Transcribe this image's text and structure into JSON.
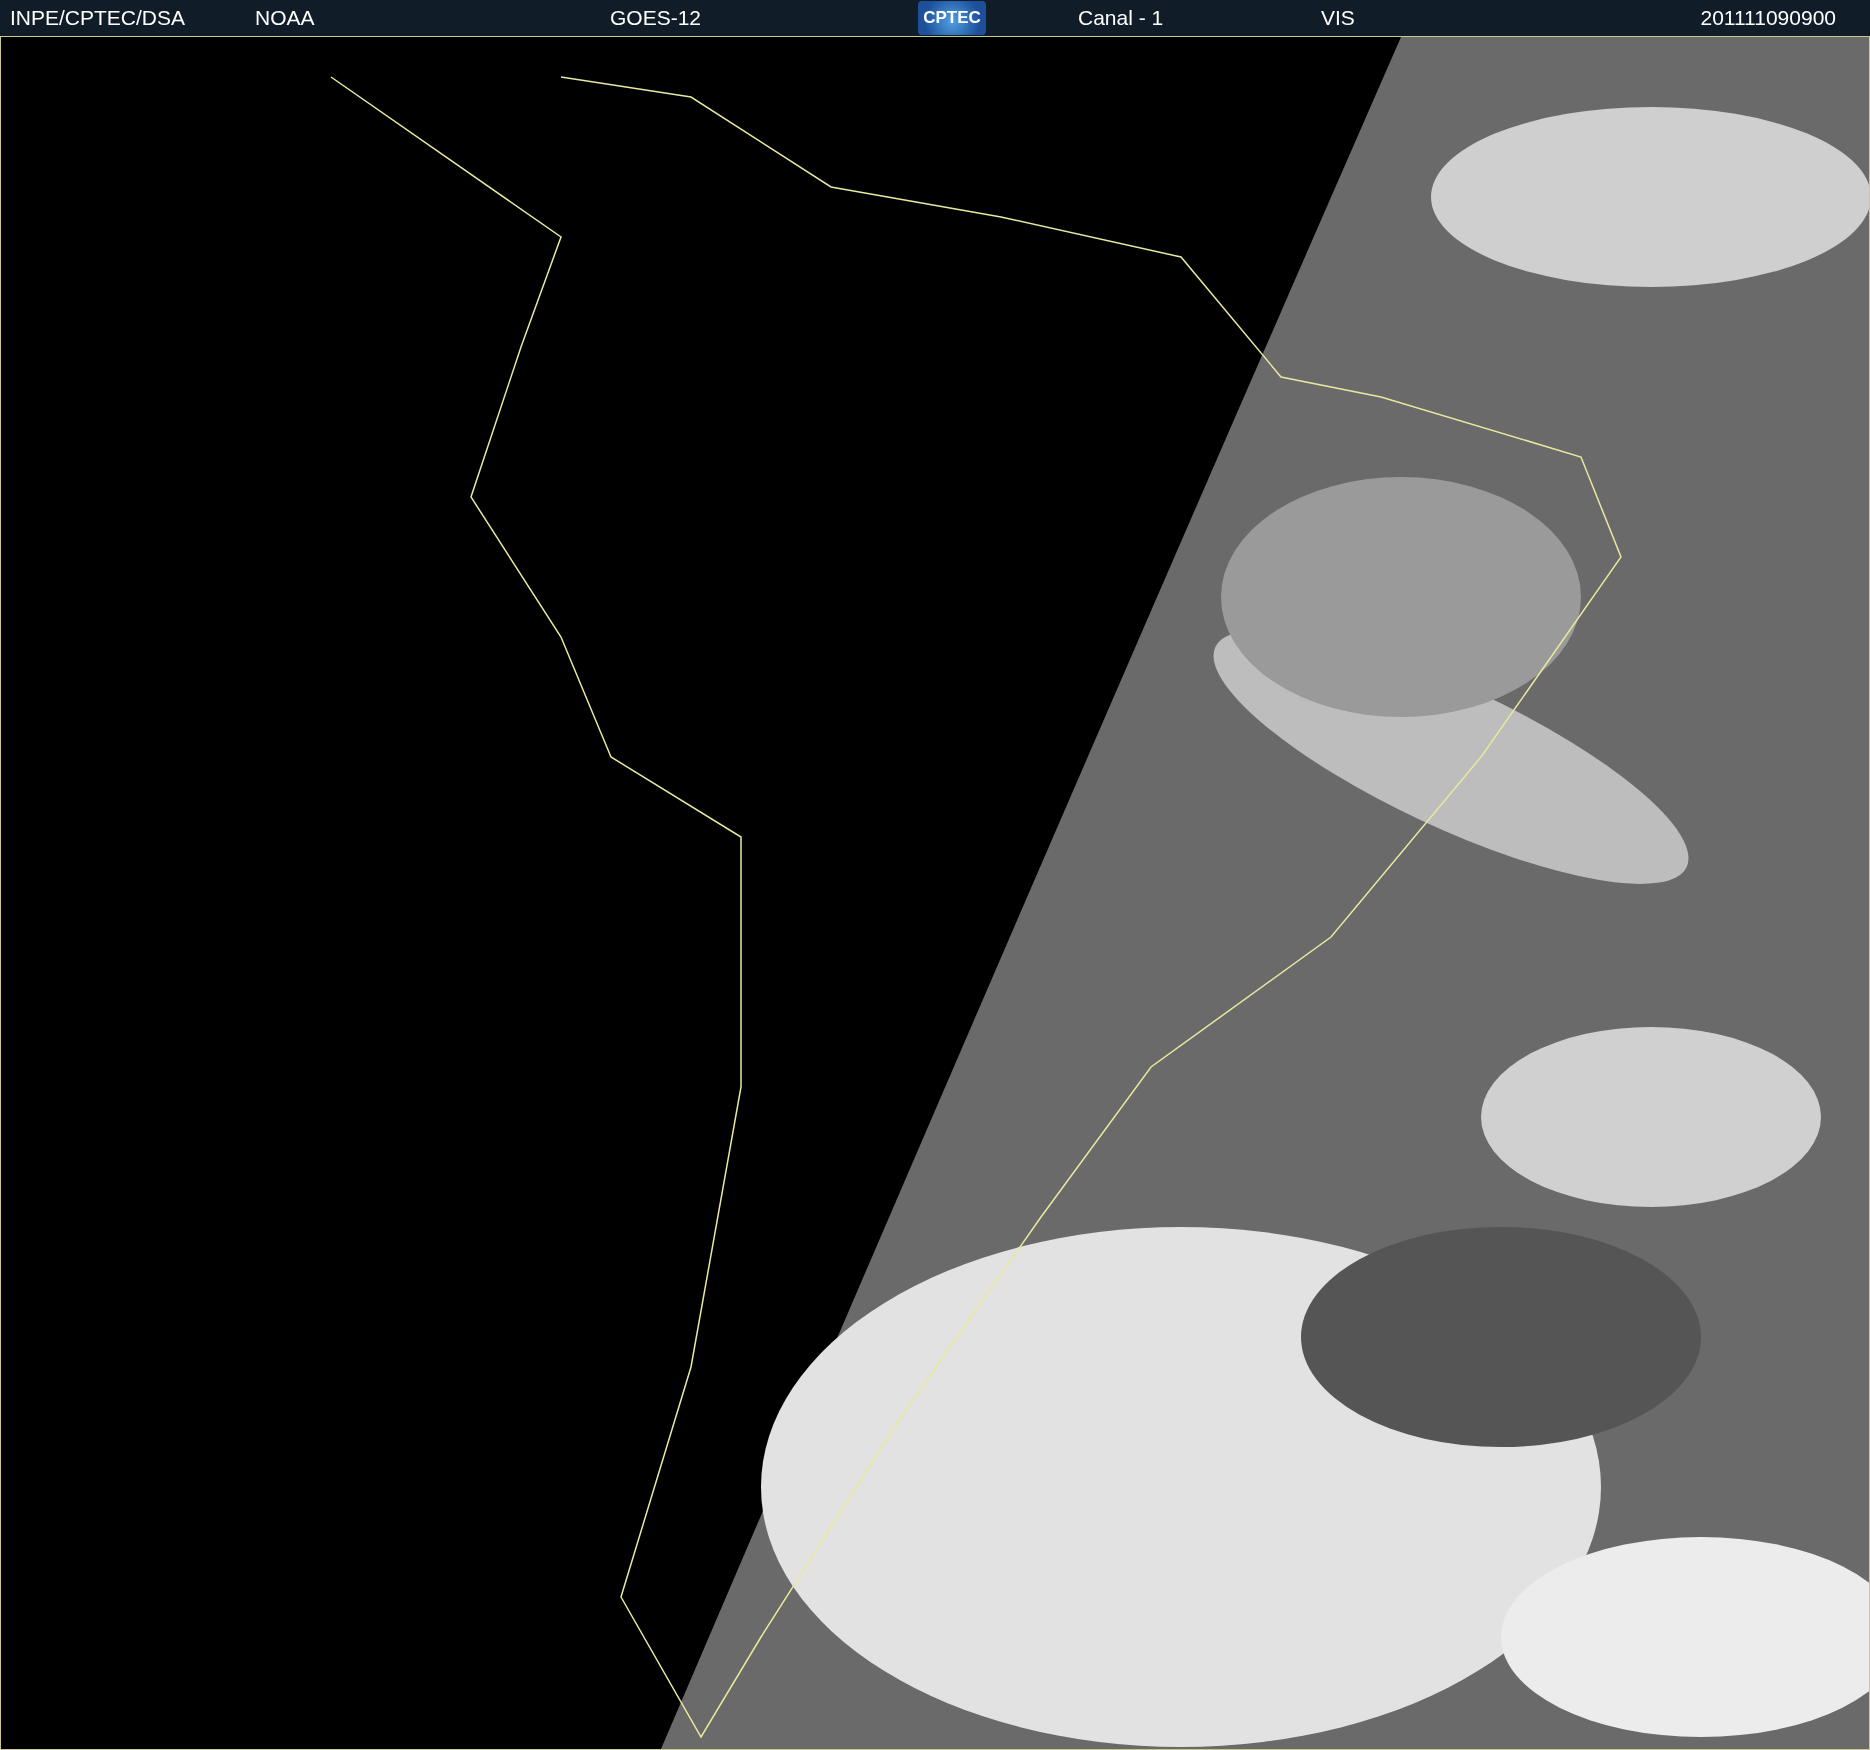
{
  "header": {
    "source": "INPE/CPTEC/DSA",
    "agency": "NOAA",
    "satellite": "GOES-12",
    "logo": "CPTEC",
    "channel": "Canal - 1",
    "band": "VIS",
    "timestamp": "201111090900"
  }
}
